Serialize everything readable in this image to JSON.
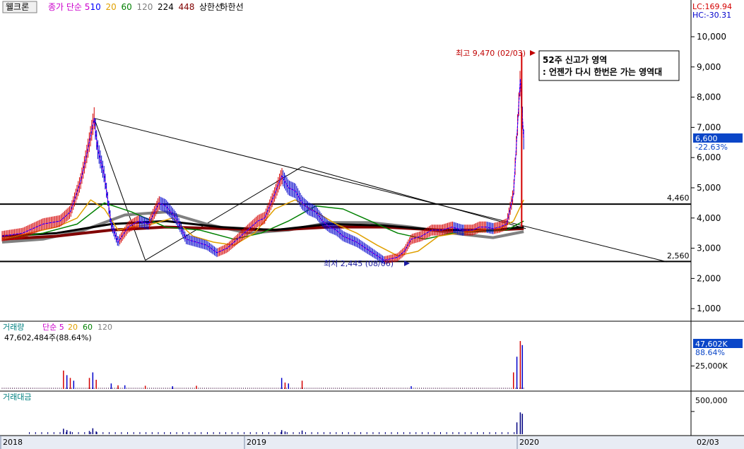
{
  "header": {
    "stock_name": "웰크론",
    "legend_items": [
      {
        "label": "종가 단순 5",
        "color": "#cc00cc"
      },
      {
        "label": "10",
        "color": "#0000ff"
      },
      {
        "label": "20",
        "color": "#e0a000"
      },
      {
        "label": "60",
        "color": "#008000"
      },
      {
        "label": "120",
        "color": "#808080"
      },
      {
        "label": "224",
        "color": "#000000"
      },
      {
        "label": "448",
        "color": "#800000"
      },
      {
        "label": "상한선",
        "color": "#000000"
      },
      {
        "label": "하한선",
        "color": "#000000"
      }
    ],
    "lc": "LC:169.94",
    "hc": "HC:-30.31"
  },
  "annotations": {
    "high_label": "최고 9,470 (02/03)",
    "low_label": "최저 2,445 (08/06)",
    "box_line1": "52주 신고가 영역",
    "box_line2": ": 언젠가 다시 한번은 가는 영역대",
    "level_upper": "4,460",
    "level_lower": "2,560",
    "current_price": "6,600",
    "current_change": "-22.63%"
  },
  "volume_panel": {
    "legend_title": "거래량",
    "legend_items": [
      {
        "label": "단순 5",
        "color": "#cc00cc"
      },
      {
        "label": "20",
        "color": "#e0a000"
      },
      {
        "label": "60",
        "color": "#008000"
      },
      {
        "label": "120",
        "color": "#808080"
      }
    ],
    "info": "47,602,484주(88.64%)",
    "current_value": "47,602K",
    "current_pct": "88.64%",
    "axis_label": "25,000K"
  },
  "amount_panel": {
    "legend_title": "거래대금",
    "axis_label": "500,000"
  },
  "xaxis": {
    "labels": [
      "2018",
      "2019",
      "2020"
    ],
    "last_date": "02/03"
  },
  "colors": {
    "up": "#d40000",
    "down": "#0000cc",
    "ma5": "#cc00cc",
    "ma10": "#0000ff",
    "ma20": "#e0a000",
    "ma60": "#008000",
    "ma120": "#808080",
    "ma224": "#000000",
    "ma448": "#800000",
    "highlight": "#0a46c8"
  },
  "chart_data": {
    "type": "line",
    "yticks": [
      1000,
      2000,
      3000,
      4000,
      5000,
      6000,
      7000,
      8000,
      9000,
      10000
    ],
    "ytick_labels": [
      "1,000",
      "2,000",
      "3,000",
      "4,000",
      "5,000",
      "6,000",
      "7,000",
      "8,000",
      "9,000",
      "10,000"
    ],
    "ylim": [
      0,
      10500
    ],
    "xlim": [
      0,
      1000
    ],
    "x_note": "trading index across Jan 2018 - Feb 2020",
    "price": {
      "x": [
        0,
        30,
        60,
        85,
        100,
        115,
        125,
        135,
        140,
        150,
        160,
        170,
        185,
        200,
        215,
        230,
        240,
        255,
        270,
        285,
        300,
        315,
        330,
        345,
        360,
        375,
        385,
        400,
        410,
        420,
        430,
        440,
        450,
        460,
        470,
        480,
        490,
        500,
        520,
        540,
        560,
        580,
        590,
        600,
        615,
        630,
        645,
        660,
        675,
        690,
        700,
        710,
        720,
        730,
        740,
        750,
        755,
        760,
        765
      ],
      "y": [
        3400,
        3500,
        3800,
        3900,
        4200,
        5200,
        6200,
        7300,
        6300,
        5400,
        3800,
        3200,
        3700,
        3900,
        3800,
        4500,
        4400,
        4000,
        3300,
        3200,
        3100,
        2850,
        3000,
        3300,
        3600,
        3900,
        4000,
        4800,
        5400,
        5000,
        4900,
        4500,
        4300,
        4200,
        3900,
        3700,
        3600,
        3400,
        3200,
        2900,
        2600,
        2700,
        2900,
        3300,
        3400,
        3600,
        3600,
        3700,
        3600,
        3600,
        3700,
        3700,
        3650,
        3700,
        3800,
        4800,
        6700,
        8600,
        6600
      ]
    },
    "ma20": {
      "x": [
        0,
        40,
        80,
        110,
        130,
        150,
        170,
        190,
        220,
        250,
        280,
        310,
        340,
        370,
        400,
        430,
        460,
        490,
        520,
        550,
        580,
        610,
        640,
        670,
        700,
        730,
        750,
        765
      ],
      "y": [
        3300,
        3500,
        3700,
        4000,
        4600,
        4300,
        3600,
        3700,
        3800,
        4000,
        3400,
        3200,
        3100,
        3500,
        4300,
        4600,
        4200,
        3800,
        3500,
        3100,
        2750,
        2900,
        3400,
        3500,
        3600,
        3650,
        3900,
        4600
      ]
    },
    "ma60": {
      "x": [
        0,
        60,
        110,
        150,
        190,
        240,
        290,
        340,
        380,
        420,
        460,
        500,
        540,
        580,
        620,
        660,
        700,
        740,
        765
      ],
      "y": [
        3300,
        3500,
        3800,
        4500,
        4200,
        3700,
        3600,
        3300,
        3500,
        3900,
        4400,
        4300,
        3900,
        3500,
        3300,
        3500,
        3550,
        3600,
        3900
      ]
    },
    "ma120": {
      "x": [
        0,
        60,
        120,
        180,
        240,
        300,
        360,
        420,
        480,
        540,
        600,
        660,
        720,
        765
      ],
      "y": [
        3200,
        3300,
        3600,
        4100,
        4200,
        3800,
        3500,
        3600,
        3850,
        3850,
        3700,
        3500,
        3350,
        3550
      ]
    },
    "ma224": {
      "x": [
        0,
        80,
        160,
        240,
        320,
        400,
        480,
        560,
        640,
        720,
        765
      ],
      "y": [
        3400,
        3500,
        3800,
        3900,
        3700,
        3600,
        3800,
        3750,
        3600,
        3600,
        3700
      ]
    },
    "ma448": {
      "x": [
        0,
        80,
        160,
        240,
        320,
        400,
        480,
        560,
        640,
        720,
        765
      ],
      "y": [
        3300,
        3400,
        3600,
        3700,
        3650,
        3600,
        3700,
        3700,
        3600,
        3600,
        3650
      ]
    },
    "levels": [
      4460,
      2560
    ],
    "high": {
      "x": 762,
      "value": 9470,
      "date": "02/03"
    },
    "low": {
      "x": 578,
      "value": 2445,
      "date": "08/06"
    },
    "volume_ylim": [
      0,
      62000
    ],
    "volume_yticks": [
      25000
    ],
    "volume": {
      "x": [
        90,
        95,
        100,
        105,
        128,
        133,
        138,
        160,
        170,
        180,
        210,
        250,
        285,
        410,
        415,
        420,
        440,
        600,
        750,
        755,
        760,
        763
      ],
      "values": [
        20000,
        15000,
        12000,
        9000,
        12000,
        18000,
        10000,
        6000,
        4000,
        4000,
        3500,
        3000,
        3500,
        12000,
        7000,
        6000,
        9000,
        3000,
        18000,
        35000,
        52000,
        47602
      ]
    },
    "amount_ylim": [
      0,
      700000
    ],
    "amount_yticks": [
      500000
    ],
    "amount": {
      "x": [
        90,
        95,
        100,
        128,
        133,
        138,
        410,
        415,
        440,
        755,
        760,
        763
      ],
      "values": [
        120000,
        90000,
        60000,
        70000,
        130000,
        60000,
        90000,
        60000,
        80000,
        260000,
        480000,
        450000
      ]
    }
  }
}
